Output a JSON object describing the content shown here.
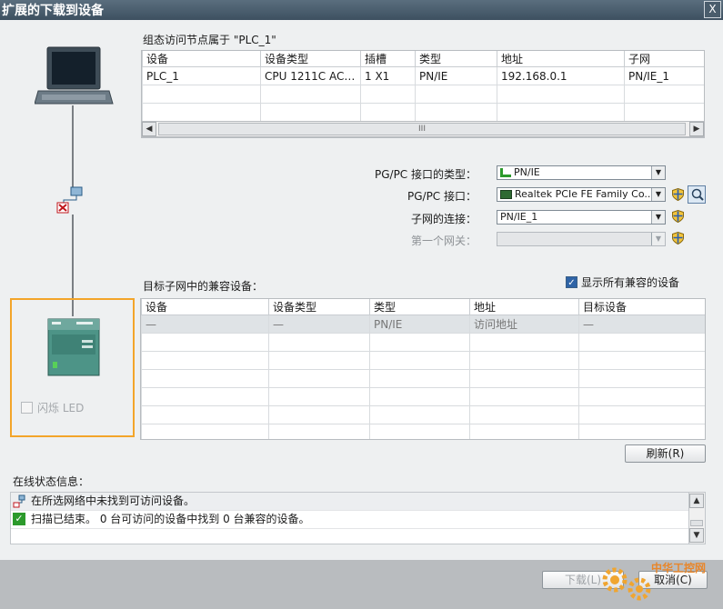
{
  "window": {
    "title": "扩展的下载到设备",
    "close_glyph": "X"
  },
  "access_nodes": {
    "heading": "组态访问节点属于 \"PLC_1\"",
    "columns": [
      "设备",
      "设备类型",
      "插槽",
      "类型",
      "地址",
      "子网"
    ],
    "rows": [
      [
        "PLC_1",
        "CPU 1211C AC/D...",
        "1 X1",
        "PN/IE",
        "192.168.0.1",
        "PN/IE_1"
      ]
    ],
    "scroll_thumb_glyph": "III"
  },
  "interface": {
    "type_label": "PG/PC 接口的类型：",
    "type_value": "PN/IE",
    "interface_label": "PG/PC 接口：",
    "interface_value": "Realtek PCIe FE Family Co...",
    "subnet_label": "子网的连接：",
    "subnet_value": "PN/IE_1",
    "gateway_label": "第一个网关：",
    "gateway_value": ""
  },
  "compatible": {
    "heading": "目标子网中的兼容设备：",
    "show_all_label": "显示所有兼容的设备",
    "show_all_checked": true,
    "columns": [
      "设备",
      "设备类型",
      "类型",
      "地址",
      "目标设备"
    ],
    "rows": [
      [
        "—",
        "—",
        "PN/IE",
        "访问地址",
        "—"
      ]
    ],
    "refresh_label": "刷新(R)"
  },
  "left": {
    "flash_led_label": "闪烁 LED",
    "flash_led_checked": false
  },
  "status": {
    "heading": "在线状态信息：",
    "messages": [
      {
        "icon": "network-error-icon",
        "text": "在所选网络中未找到可访问设备。"
      },
      {
        "icon": "check-icon",
        "text": "扫描已结束。 0 台可访问的设备中找到 0 台兼容的设备。"
      }
    ]
  },
  "footer": {
    "download_label": "下载(L)",
    "cancel_label": "取消(C)",
    "watermark_text": "中华工控网"
  },
  "colors": {
    "title_bar": "#4a5d6c",
    "highlight_frame": "#f3a52a",
    "check_green": "#2c9a2c",
    "selected_row": "#dfe3e6"
  }
}
